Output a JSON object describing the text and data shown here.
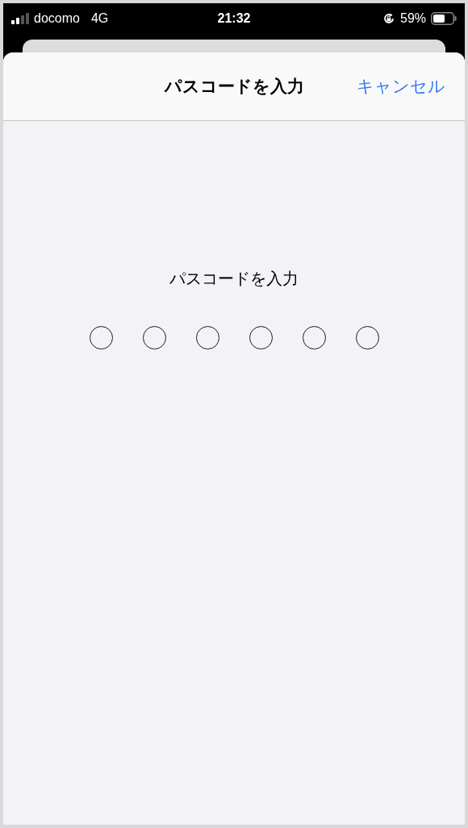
{
  "status_bar": {
    "carrier": "docomo",
    "network": "4G",
    "time": "21:32",
    "battery": "59%"
  },
  "sheet": {
    "title": "パスコードを入力",
    "cancel": "キャンセル"
  },
  "prompt": "パスコードを入力",
  "digits": [
    {
      "filled": false
    },
    {
      "filled": false
    },
    {
      "filled": false
    },
    {
      "filled": false
    },
    {
      "filled": false
    },
    {
      "filled": false
    }
  ]
}
